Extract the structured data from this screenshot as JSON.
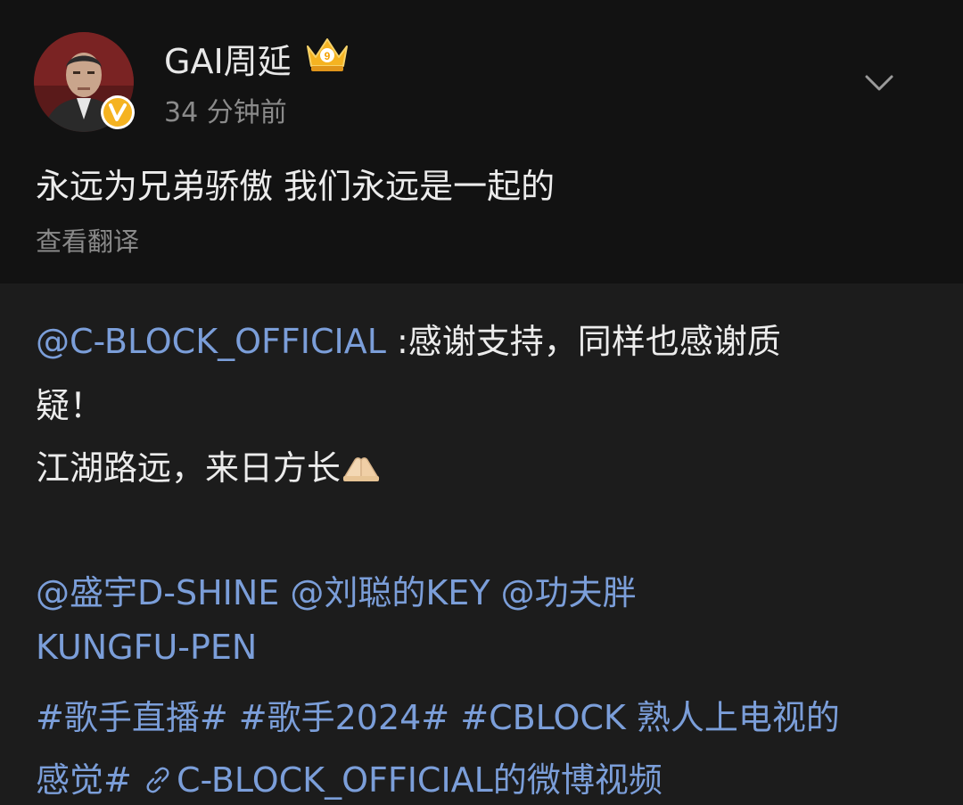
{
  "author": {
    "name": "GAI周延",
    "timestamp": "34 分钟前",
    "avatar_icon": "user-avatar",
    "badge_icon": "verified-v-icon",
    "level_icon": "crown-icon"
  },
  "post": {
    "text": "永远为兄弟骄傲 我们永远是一起的",
    "translate_label": "查看翻译"
  },
  "repost": {
    "mention_author": "@C-BLOCK_OFFICIAL",
    "line1_text": " :感谢支持，同样也感谢质",
    "line2_text": "疑！",
    "line3_text": "江湖路远，来日方长",
    "mentions_line1": "@盛宇D-SHINE @刘聪的KEY @功夫胖",
    "mentions_line2": "KUNGFU-PEN",
    "hashtags_line1": "#歌手直播# #歌手2024# #CBLOCK 熟人上电视的",
    "hashtags_line2": "感觉#",
    "video_link": "C-BLOCK_OFFICIAL的微博视频"
  },
  "colors": {
    "background": "#121212",
    "card_background": "#1c1c1c",
    "link": "#7b9ed9",
    "muted_text": "#8a8a8a"
  }
}
